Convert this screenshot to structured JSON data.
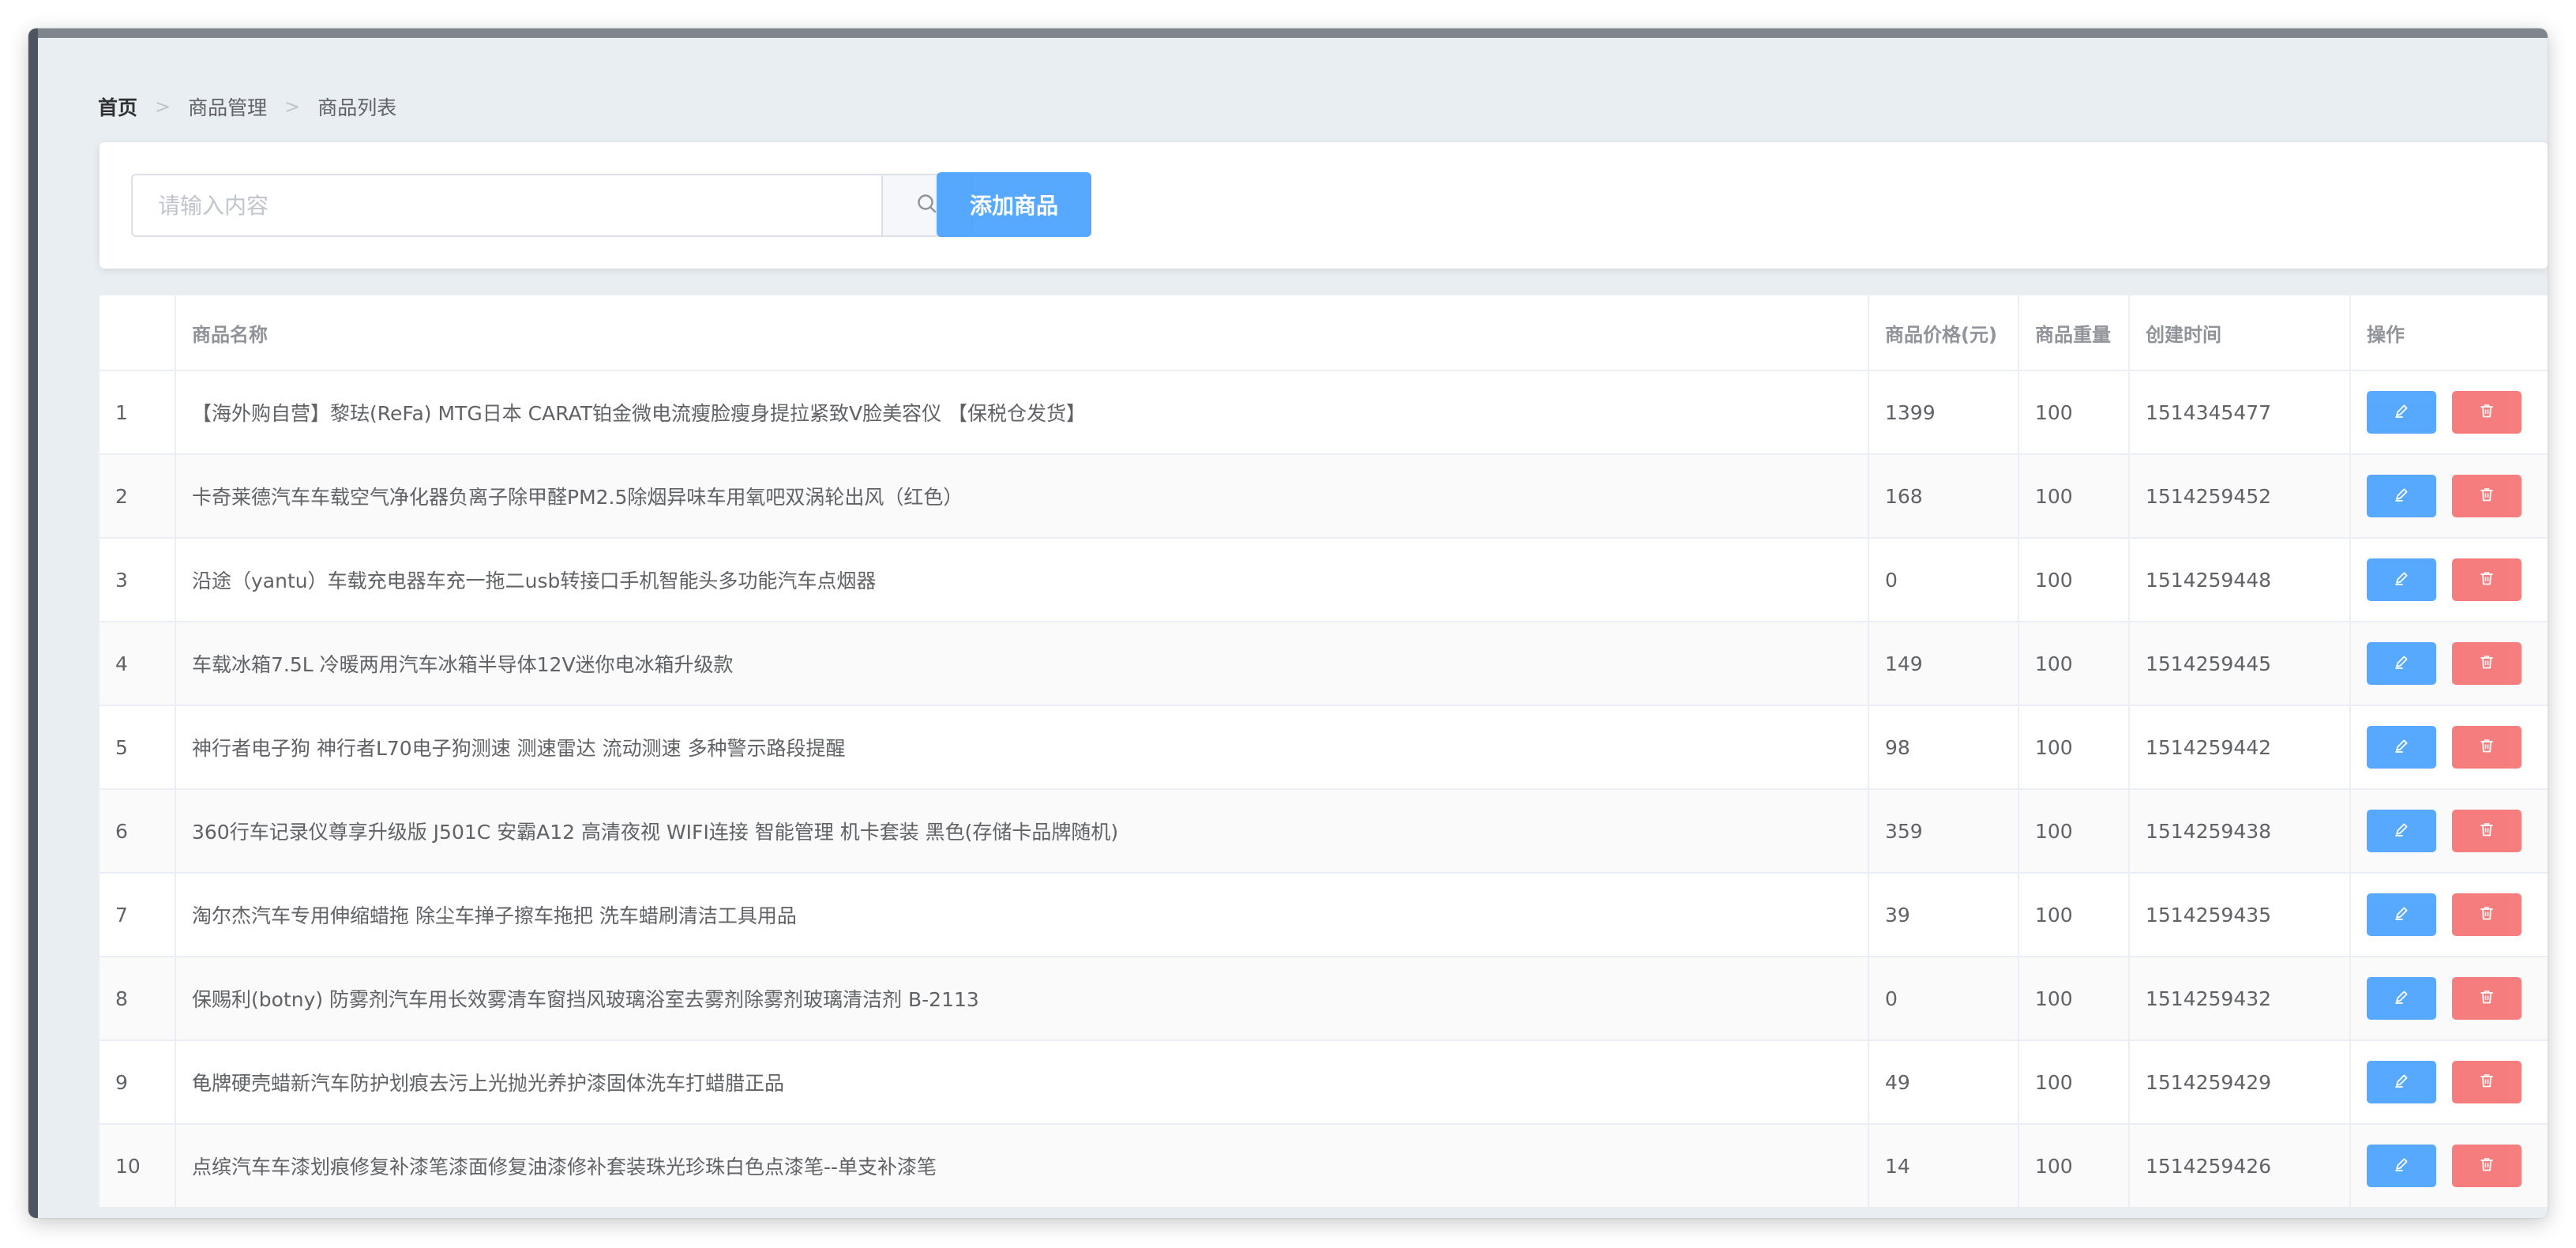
{
  "breadcrumb": {
    "items": [
      "首页",
      "商品管理",
      "商品列表"
    ],
    "separator": ">"
  },
  "search": {
    "placeholder": "请输入内容",
    "value": "",
    "icon": "search-icon"
  },
  "toolbar": {
    "add_label": "添加商品"
  },
  "table": {
    "columns": [
      "",
      "商品名称",
      "商品价格(元)",
      "商品重量",
      "创建时间",
      "操作"
    ],
    "rows": [
      {
        "index": "1",
        "name": "【海外购自营】黎珐(ReFa) MTG日本 CARAT铂金微电流瘦脸瘦身提拉紧致V脸美容仪 【保税仓发货】",
        "price": "1399",
        "weight": "100",
        "created": "1514345477"
      },
      {
        "index": "2",
        "name": "卡奇莱德汽车车载空气净化器负离子除甲醛PM2.5除烟异味车用氧吧双涡轮出风（红色）",
        "price": "168",
        "weight": "100",
        "created": "1514259452"
      },
      {
        "index": "3",
        "name": "沿途（yantu）车载充电器车充一拖二usb转接口手机智能头多功能汽车点烟器",
        "price": "0",
        "weight": "100",
        "created": "1514259448"
      },
      {
        "index": "4",
        "name": "车载冰箱7.5L 冷暖两用汽车冰箱半导体12V迷你电冰箱升级款",
        "price": "149",
        "weight": "100",
        "created": "1514259445"
      },
      {
        "index": "5",
        "name": "神行者电子狗 神行者L70电子狗测速 测速雷达 流动测速 多种警示路段提醒",
        "price": "98",
        "weight": "100",
        "created": "1514259442"
      },
      {
        "index": "6",
        "name": "360行车记录仪尊享升级版 J501C 安霸A12 高清夜视 WIFI连接 智能管理 机卡套装 黑色(存储卡品牌随机)",
        "price": "359",
        "weight": "100",
        "created": "1514259438"
      },
      {
        "index": "7",
        "name": "淘尔杰汽车专用伸缩蜡拖 除尘车掸子擦车拖把 洗车蜡刷清洁工具用品",
        "price": "39",
        "weight": "100",
        "created": "1514259435"
      },
      {
        "index": "8",
        "name": "保赐利(botny) 防雾剂汽车用长效雾清车窗挡风玻璃浴室去雾剂除雾剂玻璃清洁剂 B-2113",
        "price": "0",
        "weight": "100",
        "created": "1514259432"
      },
      {
        "index": "9",
        "name": "龟牌硬壳蜡新汽车防护划痕去污上光抛光养护漆固体洗车打蜡腊正品",
        "price": "49",
        "weight": "100",
        "created": "1514259429"
      },
      {
        "index": "10",
        "name": "点缤汽车车漆划痕修复补漆笔漆面修复油漆修补套装珠光珍珠白色点漆笔--单支补漆笔",
        "price": "14",
        "weight": "100",
        "created": "1514259426"
      }
    ],
    "row_actions": {
      "edit_icon": "edit-icon",
      "delete_icon": "delete-icon"
    }
  },
  "colors": {
    "primary": "#409eff",
    "danger": "#f56c6c",
    "page_bg": "#e9eef3"
  }
}
